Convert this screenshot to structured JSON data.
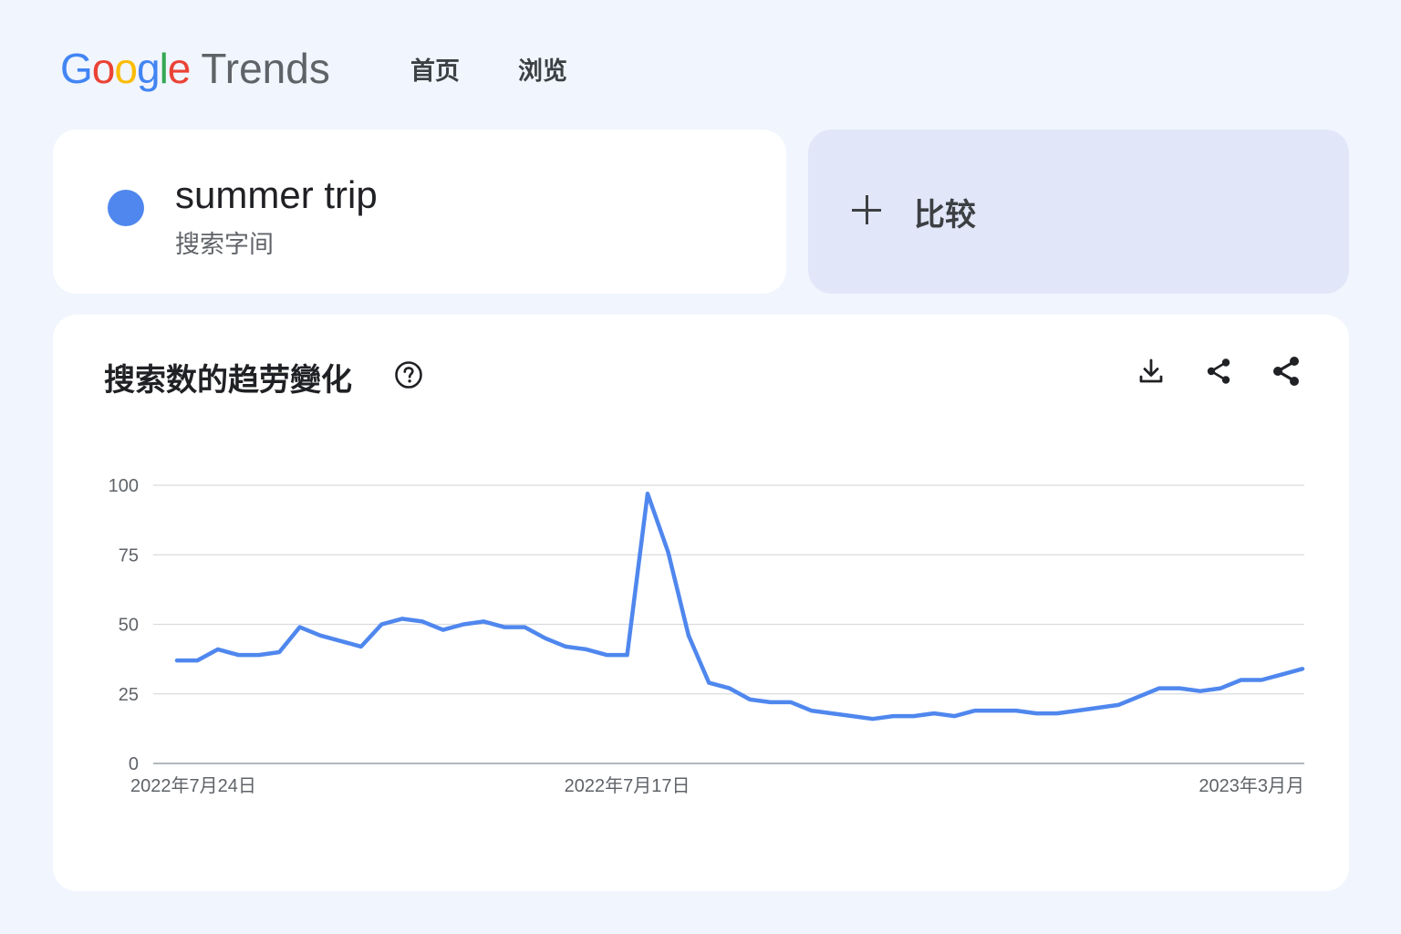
{
  "header": {
    "logo": {
      "letters": [
        "G",
        "o",
        "o",
        "g",
        "l",
        "e"
      ],
      "product": "Trends"
    },
    "nav": [
      {
        "label": "首页"
      },
      {
        "label": "浏览"
      }
    ]
  },
  "term": {
    "name": "summer trip",
    "type": "搜索字间",
    "color": "#4f87ee"
  },
  "compare": {
    "label": "比较"
  },
  "chart_card": {
    "title": "搜索数的趋劳變化",
    "icons": [
      "help-icon",
      "download-icon",
      "share-icon",
      "share-icon"
    ]
  },
  "colors": {
    "background": "#f1f5fd",
    "card": "#ffffff",
    "compare_card": "#e1e7f9",
    "series": "#4f87ee"
  },
  "chart_data": {
    "type": "line",
    "title": "搜索数的趋劳變化",
    "ylim": [
      0,
      100
    ],
    "yticks": [
      "100",
      "75",
      "50",
      "25",
      "0"
    ],
    "xticks": [
      {
        "index": 0,
        "label": "2022年7月24日"
      },
      {
        "index": 22,
        "label": "2022年7月17日"
      },
      {
        "index": 53,
        "label": "2023年3月月"
      }
    ],
    "grid": true,
    "series": [
      {
        "color": "#4f87ee",
        "values": [
          37,
          37,
          41,
          39,
          39,
          40,
          49,
          46,
          44,
          42,
          50,
          52,
          51,
          48,
          50,
          51,
          49,
          49,
          45,
          42,
          41,
          39,
          39,
          97,
          76,
          46,
          29,
          27,
          23,
          22,
          22,
          19,
          18,
          17,
          16,
          17,
          17,
          18,
          17,
          19,
          19,
          19,
          18,
          18,
          19,
          20,
          21,
          24,
          27,
          27,
          26,
          27,
          30,
          30,
          32,
          34
        ]
      }
    ]
  }
}
